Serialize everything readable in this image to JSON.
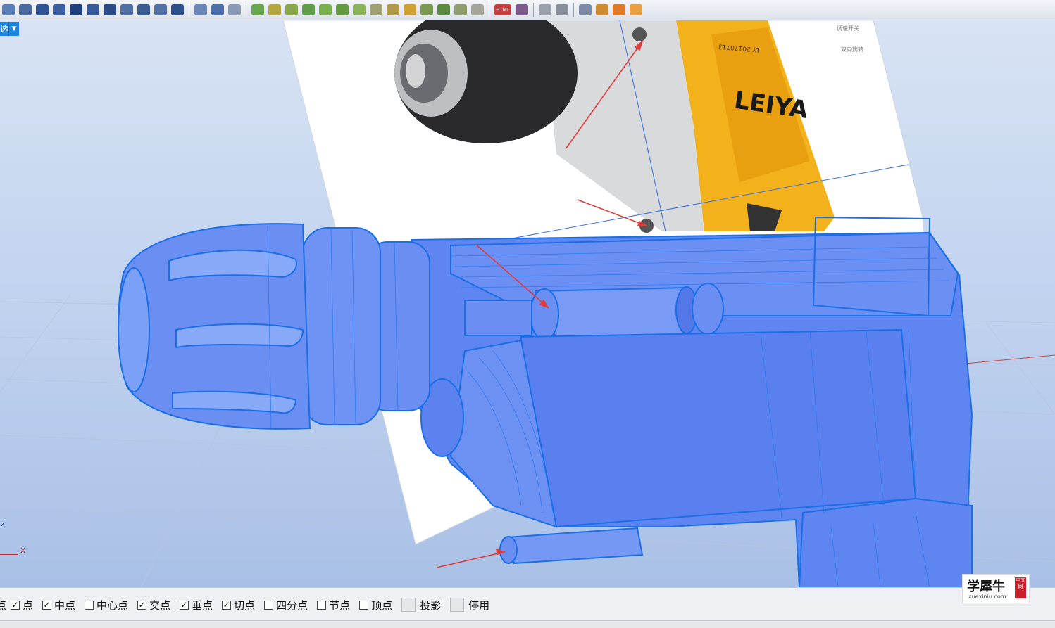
{
  "toolbar": {
    "icons": [
      "view-icon",
      "layer-icon",
      "cursor-icon",
      "select-icon",
      "move-icon",
      "rotate-icon",
      "curve-icon",
      "arc-icon",
      "surface-icon",
      "loft-icon",
      "solid-icon",
      "boolean-icon",
      "fillet-icon",
      "eye-icon",
      "paint-icon",
      "render-icon",
      "light-icon",
      "material-icon",
      "html-icon",
      "export-icon",
      "print-icon",
      "options-icon",
      "monitor-icon",
      "help-icon"
    ],
    "html_label": "HTML"
  },
  "viewport": {
    "tab_label": "透",
    "axis_z": "z",
    "axis_x": "x",
    "reference_image": {
      "brand_text": "LEIYA",
      "model_text": "LY 20170713",
      "side_notes": [
        "调速开关",
        "双向旋转"
      ]
    },
    "colors": {
      "model_blue": "#5f86f0",
      "edge_blue": "#1a6fe8",
      "drill_yellow": "#f3b21b",
      "arrow_red": "#e33a3a"
    }
  },
  "statusbar": {
    "snaps": [
      {
        "label": "点",
        "checked": true
      },
      {
        "label": "中点",
        "checked": true
      },
      {
        "label": "中心点",
        "checked": false
      },
      {
        "label": "交点",
        "checked": true
      },
      {
        "label": "垂点",
        "checked": true
      },
      {
        "label": "切点",
        "checked": true
      },
      {
        "label": "四分点",
        "checked": false
      },
      {
        "label": "节点",
        "checked": false
      },
      {
        "label": "顶点",
        "checked": false
      }
    ],
    "truncated_prefix": "点",
    "project_label": "投影",
    "disable_label": "停用"
  },
  "watermark": {
    "title": "学犀牛",
    "seal": "中文网",
    "url": "xuexiniu.com"
  }
}
